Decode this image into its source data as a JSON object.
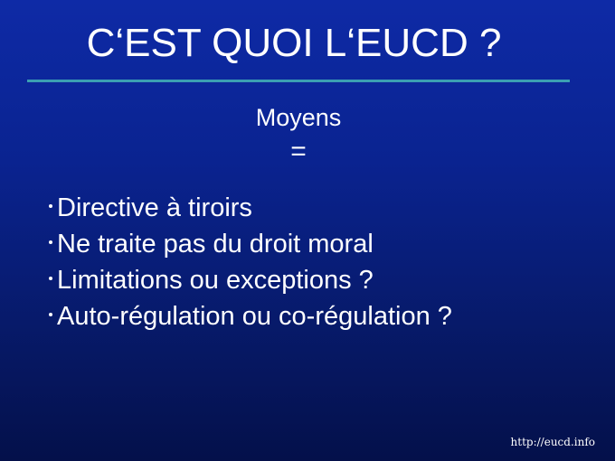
{
  "slide": {
    "title": "C‘EST QUOI L‘EUCD ?",
    "subtitle": "Moyens",
    "equals": "=",
    "bullets": [
      "Directive à tiroirs",
      "Ne traite pas du droit moral",
      "Limitations ou exceptions ?",
      "Auto-régulation ou co-régulation ?"
    ],
    "footer": "http://eucd.info"
  },
  "colors": {
    "background_top": "#0e2aa6",
    "background_bottom": "#04104a",
    "rule": "#3b9fb3",
    "text": "#ffffff"
  }
}
